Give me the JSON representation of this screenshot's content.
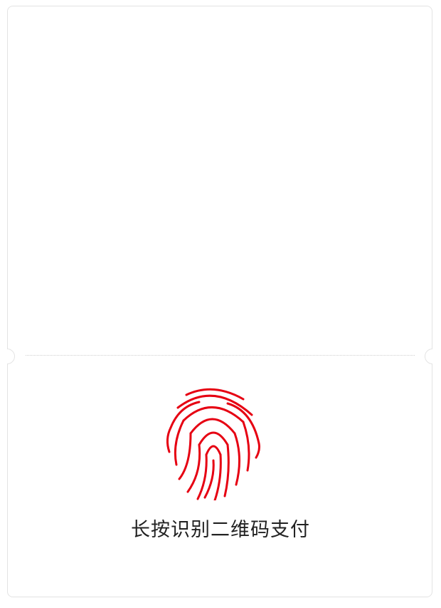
{
  "pay_card": {
    "instruction_text": "长按识别二维码支付",
    "fingerprint_icon": "fingerprint-icon",
    "accent_color": "#e60012"
  }
}
